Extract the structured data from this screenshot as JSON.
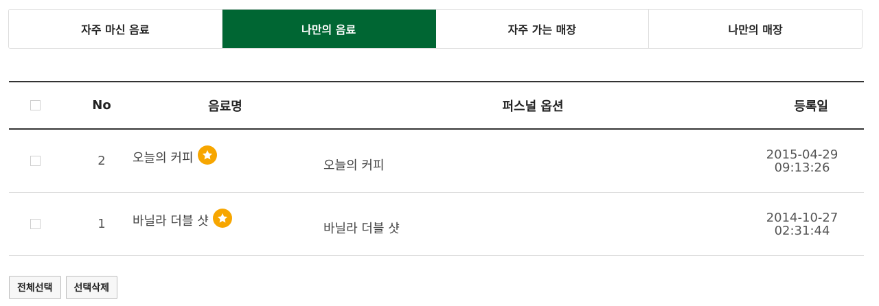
{
  "tabs": [
    {
      "label": "자주 마신 음료",
      "active": false
    },
    {
      "label": "나만의 음료",
      "active": true
    },
    {
      "label": "자주 가는 매장",
      "active": false
    },
    {
      "label": "나만의 매장",
      "active": false
    }
  ],
  "colors": {
    "active_tab": "#006633",
    "star_badge": "#f7a600"
  },
  "table": {
    "headers": {
      "no": "No",
      "name": "음료명",
      "option": "퍼스널 옵션",
      "date": "등록일"
    },
    "rows": [
      {
        "no": "2",
        "name": "오늘의 커피",
        "option": "오늘의 커피",
        "date": "2015-04-29",
        "time": "09:13:26",
        "badge_icon": "star-icon"
      },
      {
        "no": "1",
        "name": "바닐라 더블 샷",
        "option": "바닐라 더블 샷",
        "date": "2014-10-27",
        "time": "02:31:44",
        "badge_icon": "star-icon"
      }
    ]
  },
  "buttons": {
    "select_all": "전체선택",
    "delete_selected": "선택삭제"
  }
}
